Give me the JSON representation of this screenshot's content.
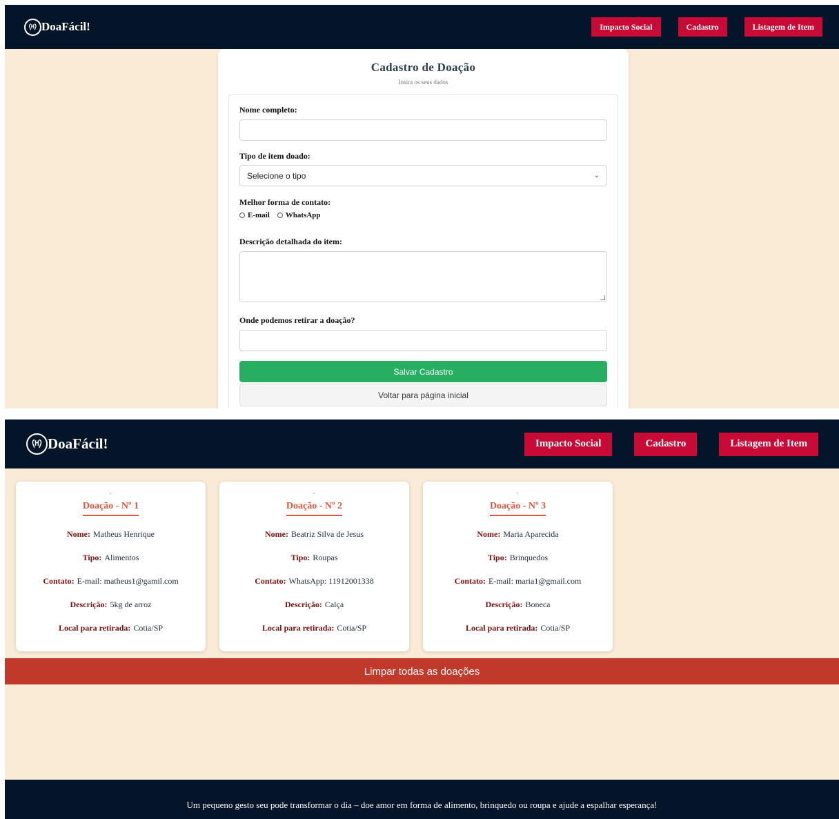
{
  "brand": {
    "name": "DoaFácil!"
  },
  "nav": {
    "items": [
      "Impacto Social",
      "Cadastro",
      "Listagem de Item"
    ]
  },
  "form": {
    "title": "Cadastro de Doação",
    "subtitle": "Insira os seus dados",
    "name_label": "Nome completo:",
    "name_value": "",
    "type_label": "Tipo de item doado:",
    "type_selected": "Selecione o tipo",
    "contact_label": "Melhor forma de contato:",
    "contact_options": [
      "E-mail",
      "WhatsApp"
    ],
    "description_label": "Descrição detalhada do item:",
    "pickup_label": "Onde podemos retirar a doação?",
    "save_label": "Salvar Cadastro",
    "back_label": "Voltar para página inicial"
  },
  "listing": {
    "keys": {
      "name": "Nome:",
      "type": "Tipo:",
      "contact": "Contato:",
      "description": "Descrição:",
      "pickup": "Local para retirada:"
    },
    "donations": [
      {
        "title": "Doação - Nº 1",
        "name": "Matheus Henrique",
        "type": "Alimentos",
        "contact": "E-mail: matheus1@gamil.com",
        "description": "5kg de arroz",
        "pickup": "Cotia/SP"
      },
      {
        "title": "Doação - Nº 2",
        "name": "Beatriz Silva de Jesus",
        "type": "Roupas",
        "contact": "WhatsApp: 11912001338",
        "description": "Calça",
        "pickup": "Cotia/SP"
      },
      {
        "title": "Doação - Nº 3",
        "name": "Maria Aparecida",
        "type": "Brinquedos",
        "contact": "E-mail: maria1@gmail.com",
        "description": "Boneca",
        "pickup": "Cotia/SP"
      }
    ],
    "clear_label": "Limpar todas as doações"
  },
  "footer": {
    "text": "Um pequeno gesto seu pode transformar o dia – doe amor em forma de alimento, brinquedo ou roupa e ajude a espalhar esperança!"
  },
  "icons": {
    "logo": "donation-hands-icon",
    "chevron": "chevron-down-icon"
  },
  "colors": {
    "navbar": "#04152a",
    "nav_button": "#c80b36",
    "background": "#f9ebd6",
    "save": "#27ae60",
    "clear": "#c0392b",
    "card_title": "#e05740",
    "card_key": "#7b0e0e"
  }
}
